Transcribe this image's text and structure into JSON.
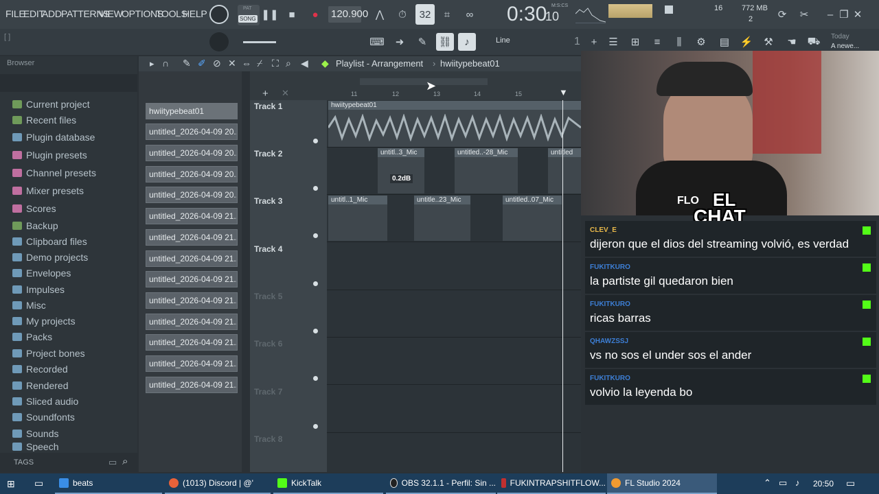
{
  "menu": [
    "FILE",
    "EDIT",
    "ADD",
    "PATTERNS",
    "VIEW",
    "OPTIONS",
    "TOOLS",
    "HELP"
  ],
  "transport": {
    "pat_label": "PAT",
    "song_label": "SONG",
    "tempo": "120.900",
    "time": "0:30",
    "time_ms": "10",
    "time_unit": "M:S:CS",
    "hint": "[ ]"
  },
  "stats": {
    "cpu": "16",
    "memory": "772 MB",
    "voices": "2"
  },
  "snap": {
    "value": "Line",
    "pattern_num": "1"
  },
  "news": {
    "title": "Today",
    "subtitle": "A newe..."
  },
  "browser": {
    "title": "Browser",
    "items": [
      "Current project",
      "Recent files",
      "Plugin database",
      "Plugin presets",
      "Channel presets",
      "Mixer presets",
      "Scores",
      "Backup",
      "Clipboard files",
      "Demo projects",
      "Envelopes",
      "Impulses",
      "Misc",
      "My projects",
      "Packs",
      "Project bones",
      "Recorded",
      "Rendered",
      "Sliced audio",
      "Soundfonts",
      "Sounds",
      "Speech"
    ],
    "tags_label": "TAGS"
  },
  "patterns": [
    "hwiitypebeat01",
    "untitled_2026-04-09 20..",
    "untitled_2026-04-09 20..",
    "untitled_2026-04-09 20..",
    "untitled_2026-04-09 20..",
    "untitled_2026-04-09 21..",
    "untitled_2026-04-09 21..",
    "untitled_2026-04-09 21..",
    "untitled_2026-04-09 21..",
    "untitled_2026-04-09 21..",
    "untitled_2026-04-09 21..",
    "untitled_2026-04-09 21..",
    "untitled_2026-04-09 21..",
    "untitled_2026-04-09 21.."
  ],
  "playlist": {
    "title": "Playlist - Arrangement",
    "pattern": "hwiitypebeat01",
    "ruler": [
      "11",
      "12",
      "13",
      "14",
      "15"
    ],
    "tracks": [
      "Track 1",
      "Track 2",
      "Track 3",
      "Track 4",
      "Track 5",
      "Track 6",
      "Track 7",
      "Track 8"
    ],
    "clips": {
      "c1": "hwiitypebeat01",
      "c2a": "untitl..3_Mic",
      "c2b": "untitled..-28_Mic",
      "c2c": "untitled",
      "c3a": "untitl..1_Mic",
      "c3b": "untitle..23_Mic",
      "c3c": "untitled..07_Mic"
    },
    "tooltip": "0.2dB"
  },
  "overlay": {
    "line1": "EL",
    "line2": "CHAT",
    "cam_text": "FLO"
  },
  "chat": [
    {
      "user": "CLEV_E",
      "user_color": "#e8b84a",
      "text": "dijeron que el dios del streaming volvió, es verdad"
    },
    {
      "user": "FUKITKURO",
      "user_color": "#3d7fd6",
      "text": "la partiste gil quedaron bien"
    },
    {
      "user": "FUKITKURO",
      "user_color": "#3d7fd6",
      "text": "ricas barras"
    },
    {
      "user": "QHAWZSSJ",
      "user_color": "#3d7fd6",
      "text": "vs no sos el under sos el ander"
    },
    {
      "user": "FUKITKURO",
      "user_color": "#3d7fd6",
      "text": "volvio la leyenda bo"
    }
  ],
  "taskbar": {
    "items": [
      "beats",
      "(1013) Discord | @'",
      "KickTalk",
      "OBS 32.1.1 - Perfil: Sin ...",
      "FUKINTRAPSHITFLOW...",
      "FL Studio 2024"
    ],
    "clock": "20:50"
  }
}
